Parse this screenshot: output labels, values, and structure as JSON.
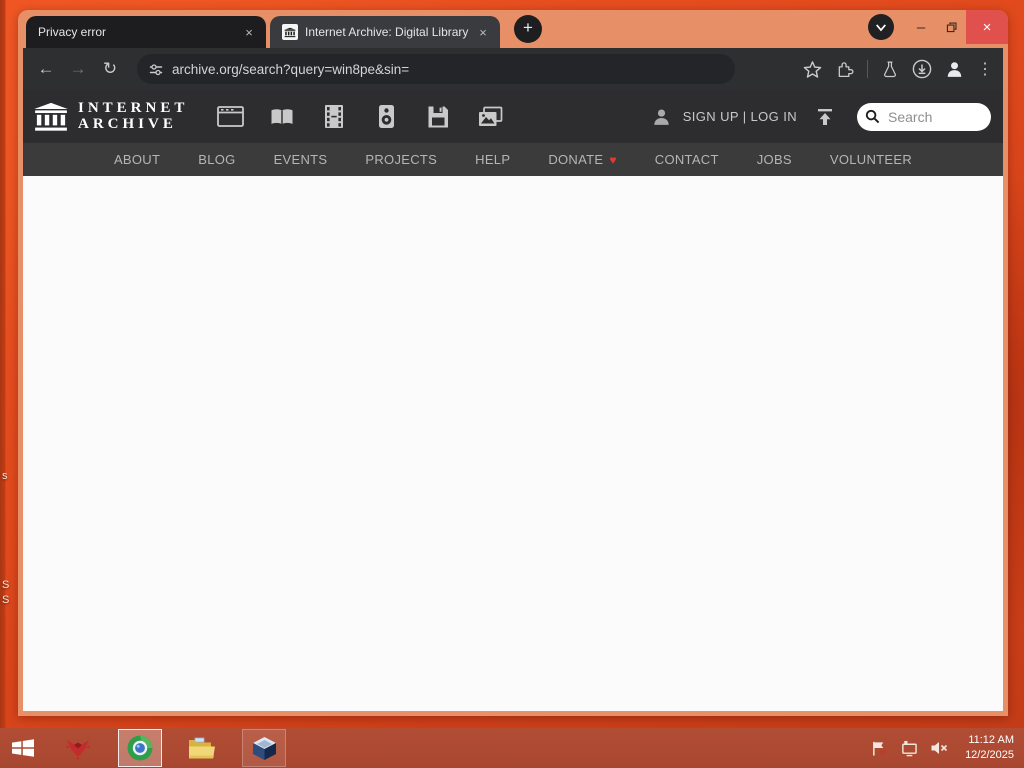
{
  "desktop": {
    "fragments": [
      "s",
      "S",
      "S"
    ]
  },
  "browser": {
    "tabs": [
      {
        "title": "Privacy error",
        "close": "×"
      },
      {
        "title": "Internet Archive: Digital Library",
        "close": "×"
      }
    ],
    "new_tab": "+",
    "url": "archive.org/search?query=win8pe&sin=",
    "controls": {
      "minimize": "–",
      "close": "×"
    },
    "menu_dots": "⋮",
    "back": "←",
    "forward": "→",
    "reload": "↻"
  },
  "site": {
    "logo_line1": "INTERNET",
    "logo_line2": "ARCHIVE",
    "auth": "SIGN UP | LOG IN",
    "search_placeholder": "Search",
    "nav": [
      {
        "label": "ABOUT"
      },
      {
        "label": "BLOG"
      },
      {
        "label": "EVENTS"
      },
      {
        "label": "PROJECTS"
      },
      {
        "label": "HELP"
      },
      {
        "label": "DONATE",
        "heart": "♥"
      },
      {
        "label": "CONTACT"
      },
      {
        "label": "JOBS"
      },
      {
        "label": "VOLUNTEER"
      }
    ]
  },
  "taskbar": {
    "time": "11:12 AM",
    "date": "12/2/2025"
  },
  "colors": {
    "frame": "#e78f66",
    "desktop": "#e14a1d",
    "taskbar": "#ae4a32",
    "close_red": "#e0514d",
    "heart_red": "#e53935",
    "active_tab": "#3a3b3e"
  }
}
